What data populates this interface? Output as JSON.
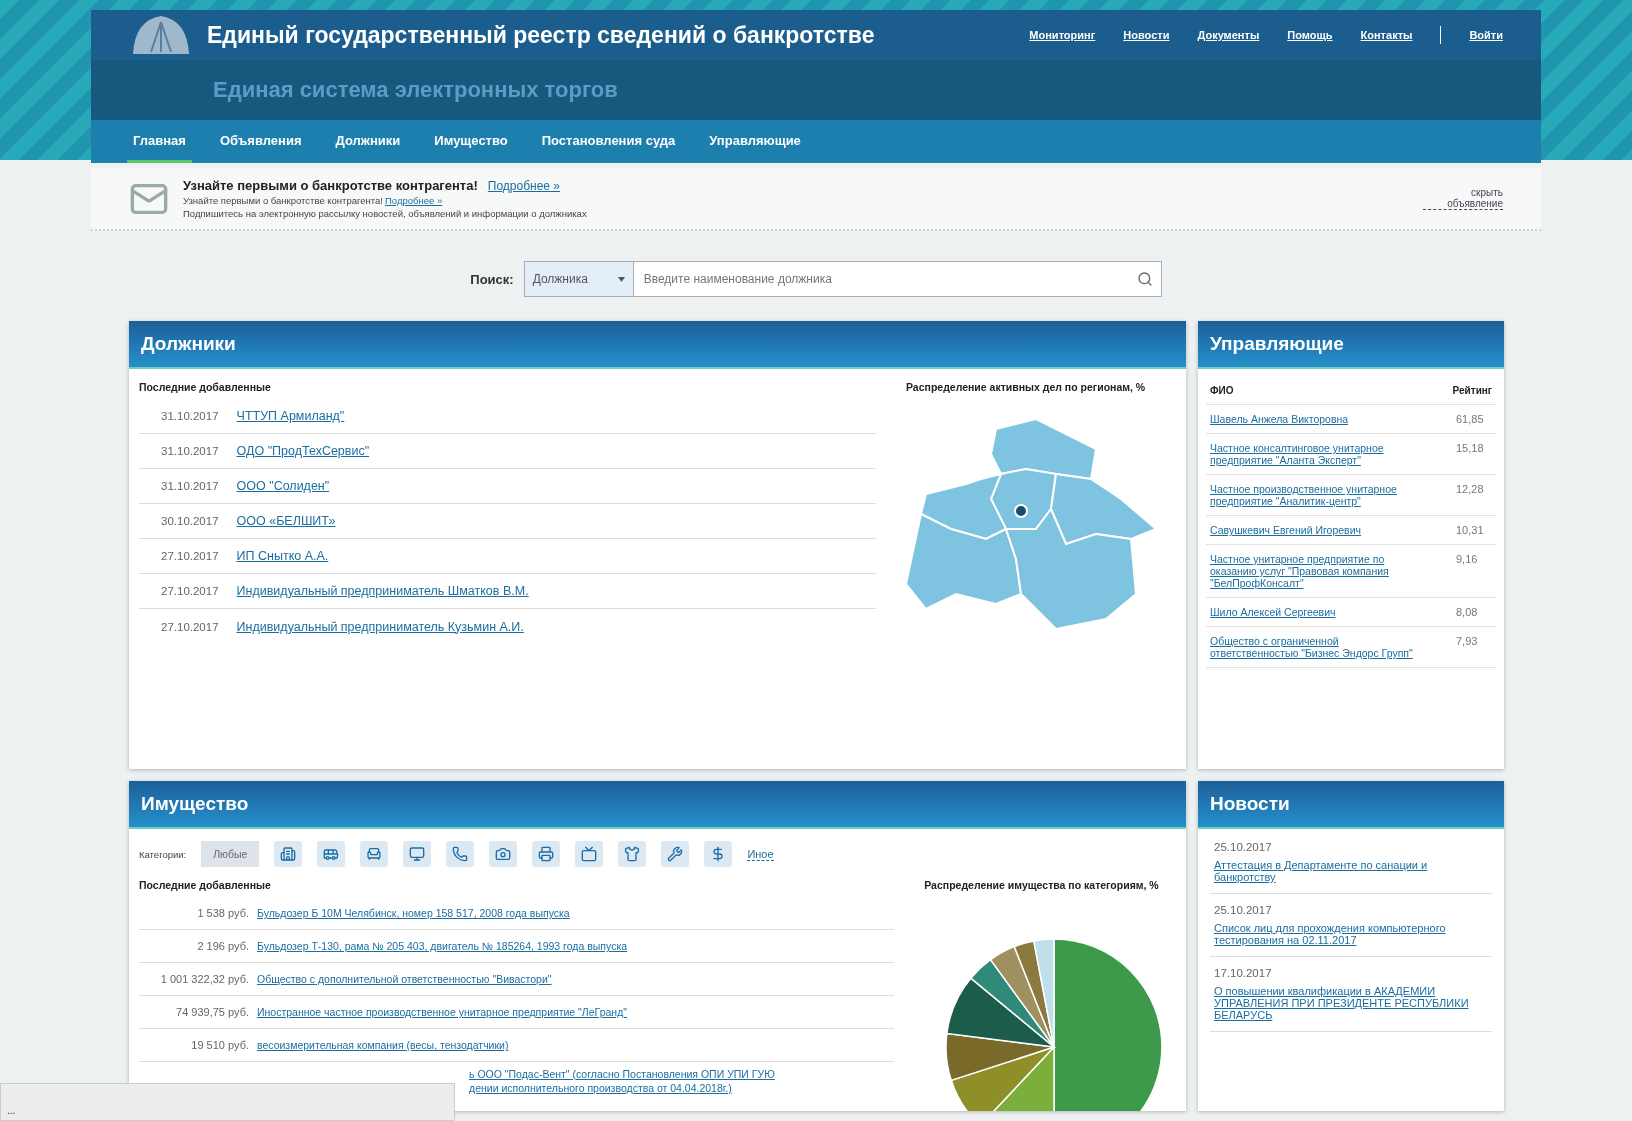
{
  "header": {
    "title": "Единый государственный реестр сведений о банкротстве",
    "links": [
      {
        "label": "Мониторинг"
      },
      {
        "label": "Новости"
      },
      {
        "label": "Документы"
      },
      {
        "label": "Помощь"
      },
      {
        "label": "Контакты"
      }
    ],
    "login": "Войти",
    "subtitle": "Единая система электронных торгов"
  },
  "nav": [
    {
      "label": "Главная",
      "selected": true
    },
    {
      "label": "Объявления",
      "selected": false
    },
    {
      "label": "Должники",
      "selected": false
    },
    {
      "label": "Имущество",
      "selected": false
    },
    {
      "label": "Постановления суда",
      "selected": false
    },
    {
      "label": "Управляющие",
      "selected": false
    }
  ],
  "promo": {
    "heading": "Узнайте первыми о банкротстве контрагента!",
    "more": "Подробнее »",
    "line": "Узнайте первыми о банкротстве контрагента!",
    "line_link": "Подробнее »",
    "description": "Подпишитесь на электронную рассылку новостей, объявлений и информации о должниках",
    "hide": "скрыть объявление"
  },
  "search": {
    "label": "Поиск:",
    "category": "Должника",
    "placeholder": "Введите наименование должника"
  },
  "debtors": {
    "title": "Должники",
    "subtitle": "Последние добавленные",
    "map_caption": "Распределение активных дел по регионам, %",
    "rows": [
      {
        "date": "31.10.2017",
        "name": "ЧТТУП Армиланд\""
      },
      {
        "date": "31.10.2017",
        "name": "ОДО \"ПродТехСервис\""
      },
      {
        "date": "31.10.2017",
        "name": "ООО \"Солиден\""
      },
      {
        "date": "30.10.2017",
        "name": "ООО «БЕЛШИТ»"
      },
      {
        "date": "27.10.2017",
        "name": "ИП Снытко А.А."
      },
      {
        "date": "27.10.2017",
        "name": "Индивидуальный предприниматель Шматков В.М."
      },
      {
        "date": "27.10.2017",
        "name": "Индивидуальный предприниматель Кузьмин А.И."
      }
    ]
  },
  "managers": {
    "title": "Управляющие",
    "columns": [
      "ФИО",
      "Рейтинг"
    ],
    "rows": [
      {
        "name": "Шавель Анжела Викторовна",
        "rating": "61,85"
      },
      {
        "name": "Частное консалтинговое унитарное предприятие \"Аланта Эксперт\"",
        "rating": "15,18"
      },
      {
        "name": "Частное производственное унитарное предприятие \"Аналитик-центр\"",
        "rating": "12,28"
      },
      {
        "name": "Савушкевич Евгений Игоревич",
        "rating": "10,31"
      },
      {
        "name": "Частное унитарное предприятие по оказанию услуг \"Правовая компания \"БелПрофКонсалт\"",
        "rating": "9,16"
      },
      {
        "name": "Шило Алексей Сергеевич",
        "rating": "8,08"
      },
      {
        "name": "Общество с ограниченной ответственностью \"Бизнес Эндорс Групп\"",
        "rating": "7,93"
      }
    ]
  },
  "property": {
    "title": "Имущество",
    "categories_label": "Категории:",
    "categories": [
      {
        "kind": "text",
        "label": "Любые",
        "selected": true
      },
      {
        "kind": "icon",
        "selected": false
      },
      {
        "kind": "icon",
        "selected": false
      },
      {
        "kind": "icon",
        "selected": false
      },
      {
        "kind": "icon",
        "selected": false
      },
      {
        "kind": "icon",
        "selected": false
      },
      {
        "kind": "icon",
        "selected": false
      },
      {
        "kind": "icon",
        "selected": false
      },
      {
        "kind": "icon",
        "selected": false
      },
      {
        "kind": "icon",
        "selected": false
      },
      {
        "kind": "icon",
        "selected": false
      },
      {
        "kind": "icon",
        "selected": false
      },
      {
        "kind": "link",
        "label": "Иное",
        "selected": false
      }
    ],
    "subtitle": "Последние добавленные",
    "chart_caption": "Распределение имущества по категориям, %",
    "rows": [
      {
        "kind": "full",
        "price": "1 538 руб.",
        "title": "Бульдозер Б 10М Челябинск, номер 158 517, 2008 года выпуска"
      },
      {
        "kind": "full",
        "price": "2 196 руб.",
        "title": "Бульдозер Т-130, рама № 205 403, двигатель № 185264, 1993 года выпуска"
      },
      {
        "kind": "full",
        "price": "1 001 322,32 руб.",
        "title": "Общество с дополнительной ответственностью \"Вивастори\""
      },
      {
        "kind": "full",
        "price": "74 939,75 руб.",
        "title": "Иностранное частное производственное унитарное предприятие \"ЛеГранд\""
      },
      {
        "kind": "full",
        "price": "19 510 руб.",
        "title": "весоизмерительная компания (весы, тензодатчики)"
      },
      {
        "kind": "partial",
        "title": "ь ООО \"Подас-Вент\" (согласно Постановления ОПИ УПИ ГУЮ",
        "title_2": "дении исполнительного производства от 04.04.2018г.)"
      }
    ]
  },
  "news": {
    "title": "Новости",
    "items": [
      {
        "date": "25.10.2017",
        "title": "Аттестация в Департаменте по санации и банкротству"
      },
      {
        "date": "25.10.2017",
        "title": "Список лиц для прохождения компьютерного тестирования на 02.11.2017"
      },
      {
        "date": "17.10.2017",
        "title": "О повышении квалификации в АКАДЕМИИ УПРАВЛЕНИЯ ПРИ ПРЕЗИДЕНТЕ РЕСПУБЛИКИ БЕЛАРУСЬ"
      }
    ]
  },
  "status_popup": {
    "text": "..."
  }
}
